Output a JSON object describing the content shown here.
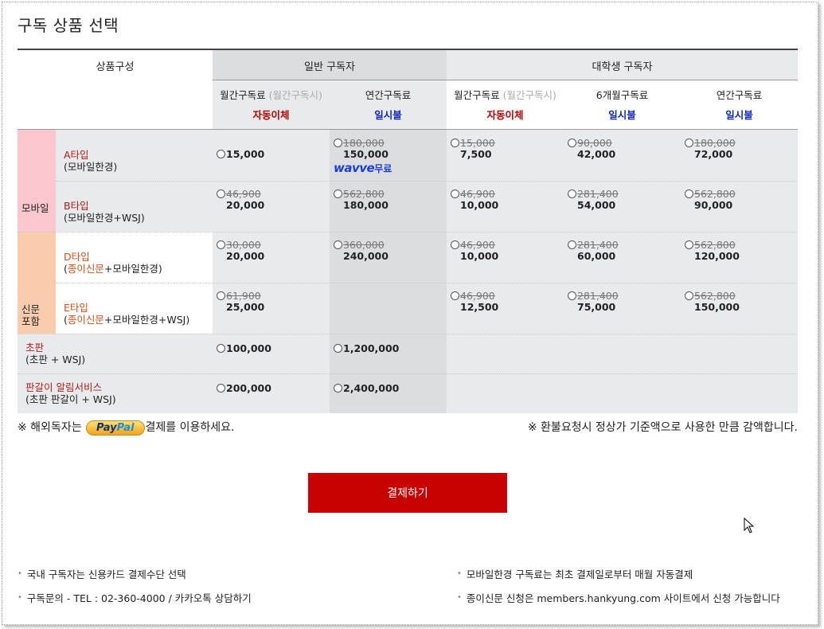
{
  "title": "구독 상품 선택",
  "header": {
    "product_col": "상품구성",
    "general_group": "일반 구독자",
    "student_group": "대학생 구독자",
    "columns": [
      {
        "name": "월간구독료",
        "note": "(월간구독시)",
        "pay": "자동이체",
        "pay_color": "#b30000"
      },
      {
        "name": "연간구독료",
        "note": "",
        "pay": "일시불",
        "pay_color": "#1028b8"
      },
      {
        "name": "월간구독료",
        "note": "(월간구독시)",
        "pay": "자동이체",
        "pay_color": "#b30000"
      },
      {
        "name": "6개월구독료",
        "note": "",
        "pay": "일시불",
        "pay_color": "#1028b8"
      },
      {
        "name": "연간구독료",
        "note": "",
        "pay": "일시불",
        "pay_color": "#1028b8"
      }
    ]
  },
  "groups": {
    "mobile": "모바일",
    "paper_line1": "신문",
    "paper_line2": "포함"
  },
  "rows": {
    "a": {
      "name": "A타입",
      "desc": "(모바일한경)",
      "c1_new": "15,000",
      "c2_old": "180,000",
      "c2_new": "150,000",
      "c3_old": "15,000",
      "c3_new": "7,500",
      "c4_old": "90,000",
      "c4_new": "42,000",
      "c5_old": "180,000",
      "c5_new": "72,000"
    },
    "b": {
      "name": "B타입",
      "desc": "(모바일한경+WSJ)",
      "c1_old": "46,900",
      "c1_new": "20,000",
      "c2_old": "562,800",
      "c2_new": "180,000",
      "c3_old": "46,900",
      "c3_new": "10,000",
      "c4_old": "281,400",
      "c4_new": "54,000",
      "c5_old": "562,800",
      "c5_new": "90,000"
    },
    "d": {
      "name": "D타입",
      "desc_open": "(",
      "desc_paper": "종이신문",
      "desc_rest": "+모바일한경)",
      "c1_old": "30,000",
      "c1_new": "20,000",
      "c2_old": "360,000",
      "c2_new": "240,000",
      "c3_old": "46,900",
      "c3_new": "10,000",
      "c4_old": "281,400",
      "c4_new": "60,000",
      "c5_old": "562,800",
      "c5_new": "120,000"
    },
    "e": {
      "name": "E타입",
      "desc_open": "(",
      "desc_paper": "종이신문",
      "desc_rest": "+모바일한경+WSJ)",
      "c1_old": "61,900",
      "c1_new": "25,000",
      "c3_old": "46,900",
      "c3_new": "12,500",
      "c4_old": "281,400",
      "c4_new": "75,000",
      "c5_old": "562,800",
      "c5_new": "150,000"
    },
    "chopan": {
      "name": "초판",
      "desc": "(초판 + WSJ)",
      "c1_new": "100,000",
      "c2_new": "1,200,000"
    },
    "pangari": {
      "name": "판갈이 알림서비스",
      "desc": "(초판 판갈이 + WSJ)",
      "c1_new": "200,000",
      "c2_new": "2,400,000"
    }
  },
  "wavve": {
    "logo": "wavve",
    "free": "무료"
  },
  "notes": {
    "left_prefix": "※ 해외독자는",
    "paypal_a": "Pay",
    "paypal_b": "Pal",
    "left_suffix": "결제를 이용하세요.",
    "right": "※ 환불요청시 정상가 기준액으로 사용한 만큼 감액합니다."
  },
  "pay_button": "결제하기",
  "footer": [
    "국내 구독자는 신용카드 결제수단 선택",
    "구독문의 - TEL : 02-360-4000 / 카카오톡 상담하기",
    "모바일한경 구독료는 최초 결제일로부터 매월 자동결제",
    "종이신문 신청은 members.hankyung.com 사이트에서 신청 가능합니다"
  ]
}
